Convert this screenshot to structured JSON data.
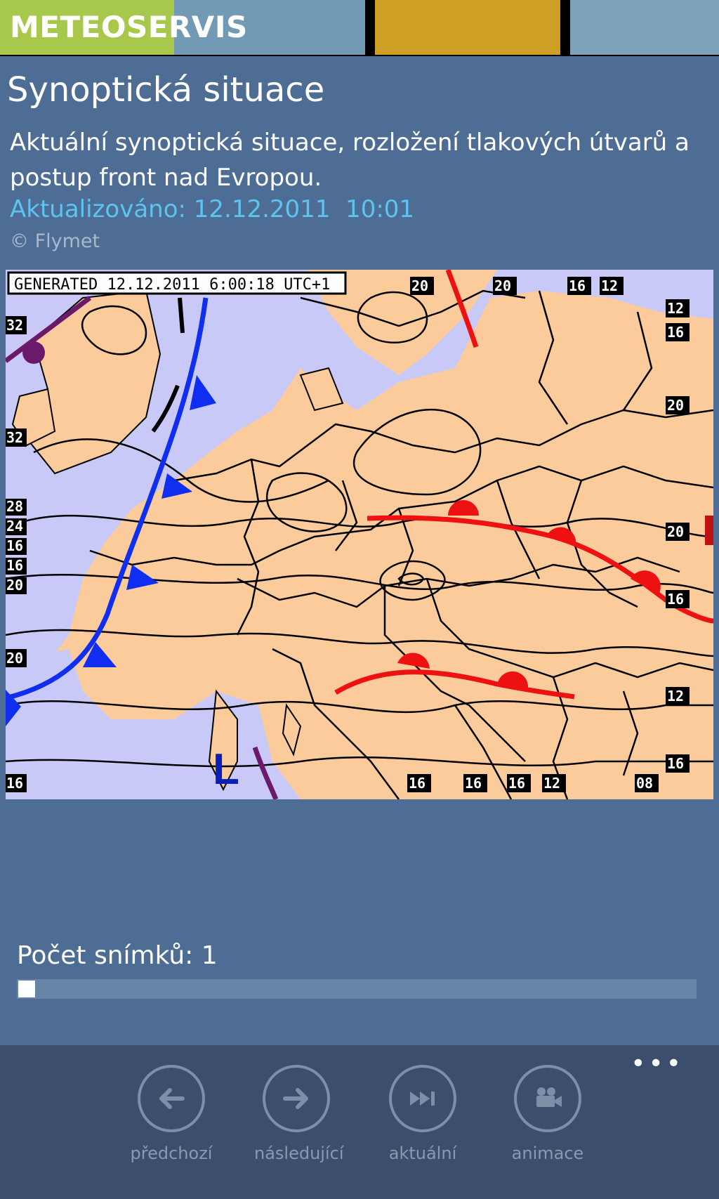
{
  "app": {
    "brand": "METEOSERVIS",
    "tiles": [
      {
        "color": "#a7c84a"
      },
      {
        "color": "#729ab5"
      },
      {
        "color": "#cf9e24"
      },
      {
        "color": "#7fa2bc"
      }
    ]
  },
  "page": {
    "title": "Synoptická situace",
    "description": "Aktuální synoptická situace, rozložení tlakových útvarů a postup front nad Evropou.",
    "updated": "Aktualizováno: 12.12.2011  10:01",
    "copyright": "© Flymet"
  },
  "map": {
    "generated_label": "GENERATED 12.12.2011 6:00:18 UTC+1",
    "pressure_letter": "L",
    "isobar_labels": [
      "20",
      "20",
      "16",
      "12",
      "12",
      "16",
      "20",
      "32",
      "32",
      "28",
      "24",
      "16",
      "16",
      "20",
      "20",
      "20",
      "16",
      "12",
      "16",
      "16",
      "16",
      "12",
      "08",
      "16",
      "16"
    ],
    "colors": {
      "land": "#fccb9c",
      "sea": "#c9c9f7",
      "cold_front": "#0f2ef0",
      "warm_front": "#ee1111",
      "occlusion": "#6b1a6b"
    }
  },
  "frames": {
    "label": "Počet snímků: 1",
    "position": 0
  },
  "appbar": {
    "more": "•••",
    "buttons": [
      {
        "label": "předchozí",
        "icon": "arrow-left-icon"
      },
      {
        "label": "následující",
        "icon": "arrow-right-icon"
      },
      {
        "label": "aktuální",
        "icon": "skip-forward-icon"
      },
      {
        "label": "animace",
        "icon": "video-camera-icon"
      }
    ]
  }
}
